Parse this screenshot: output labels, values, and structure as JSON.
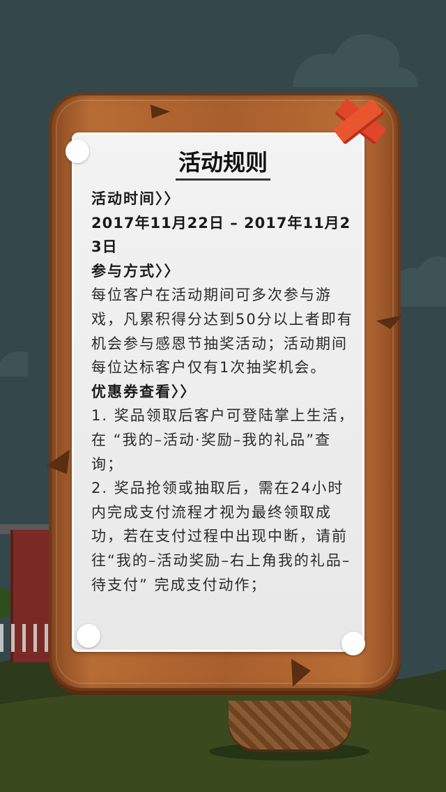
{
  "colors": {
    "sky": "#34474a",
    "hill_back": "#2d3a1b",
    "hill_front": "#3b4d20",
    "board_wood": "#a95f2d",
    "paper": "#eeeeee",
    "text": "#2a2a2a",
    "close_red": "#e2452a"
  },
  "dialog": {
    "title": "活动规则",
    "close_icon": "close-x-icon"
  },
  "rules": {
    "time_heading": "活动时间〉〉",
    "time_value": "2017年11月22日 – 2017年11月23日",
    "method_heading": "参与方式〉〉",
    "method_text": "每位客户在活动期间可多次参与游戏，凡累积得分达到50分以上者即有机会参与感恩节抽奖活动；活动期间每位达标客户仅有1次抽奖机会。",
    "coupon_heading": "优惠券查看〉〉",
    "coupon_item1": "1. 奖品领取后客户可登陆掌上生活，在 “我的–活动·奖励–我的礼品”查询；",
    "coupon_item2": "2. 奖品抢领或抽取后，需在24小时内完成支付流程才视为最终领取成功，若在支付过程中出现中断，请前往“我的–活动奖励–右上角我的礼品–待支付” 完成支付动作；"
  }
}
